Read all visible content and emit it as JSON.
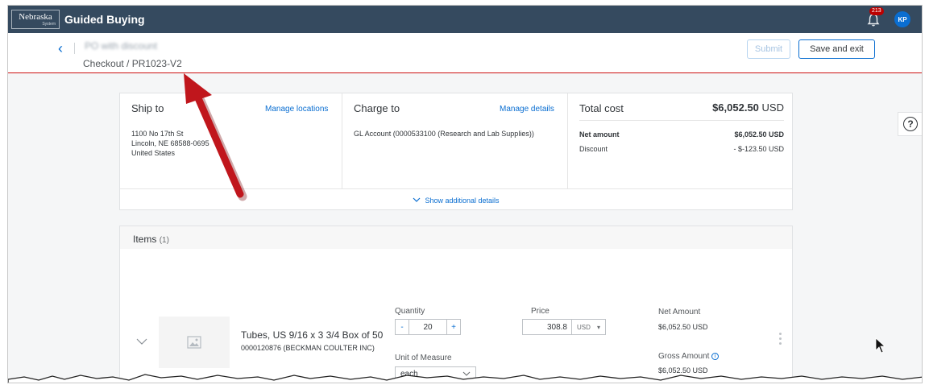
{
  "shell": {
    "logo_line1": "Nebraska",
    "logo_line2": "System",
    "app_title": "Guided Buying",
    "notification_count": "213",
    "avatar_initials": "KP"
  },
  "header": {
    "po_name": "PO with discount",
    "breadcrumb": "Checkout  /  PR1023-V2",
    "submit_label": "Submit",
    "save_exit_label": "Save and exit"
  },
  "ship_to": {
    "title": "Ship to",
    "link": "Manage locations",
    "address_line1": "1100 No 17th St",
    "address_line2": "Lincoln, NE  68588-0695",
    "address_line3": "United States"
  },
  "charge_to": {
    "title": "Charge to",
    "link": "Manage details",
    "account": "GL Account (0000533100 (Research and Lab Supplies))"
  },
  "total": {
    "title": "Total cost",
    "value": "$6,052.50",
    "currency": "USD",
    "net_label": "Net amount",
    "net_value": "$6,052.50 USD",
    "discount_label": "Discount",
    "discount_value": "- $-123.50 USD"
  },
  "details_link": "Show additional details",
  "items": {
    "title": "Items",
    "count": "(1)",
    "list": [
      {
        "name": "Tubes, US 9/16 x 3 3/4 Box of 50",
        "sku": "0000120876 (BECKMAN COULTER INC)",
        "quantity_label": "Quantity",
        "quantity": "20",
        "minus": "-",
        "plus": "+",
        "price_label": "Price",
        "price": "308.8",
        "price_currency": "USD",
        "uom_label": "Unit of Measure",
        "uom": "each",
        "net_amount_label": "Net Amount",
        "net_amount": "$6,052.50  USD",
        "gross_amount_label": "Gross Amount",
        "gross_amount": "$6,052.50  USD"
      }
    ]
  },
  "help": {
    "label": "?"
  },
  "colors": {
    "shell_bg": "#354a5f",
    "accent": "#0a6ed1",
    "divider_red": "#cc1010",
    "arrow_red": "#c0161c",
    "badge": "#bb0000"
  },
  "icons": [
    "bell-icon",
    "back-chevron-icon",
    "chevron-down-icon",
    "image-placeholder-icon",
    "info-icon",
    "kebab-menu-icon",
    "help-icon",
    "mouse-cursor-icon",
    "annotation-arrow-icon"
  ]
}
